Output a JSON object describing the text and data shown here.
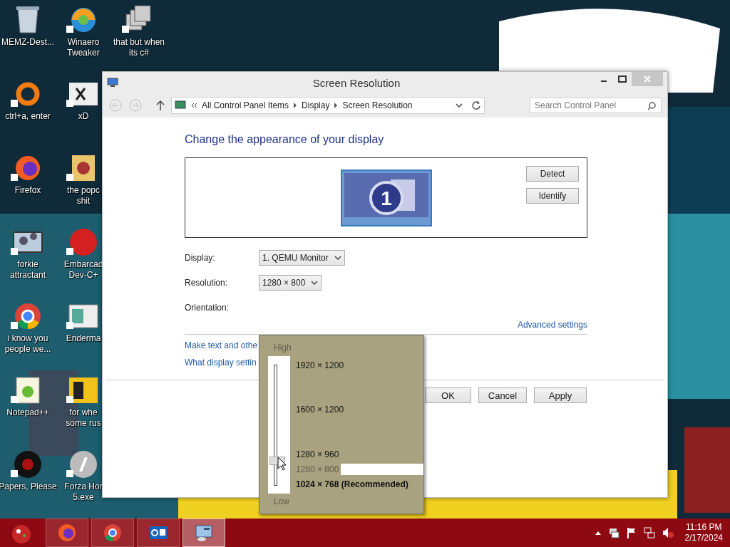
{
  "desktop": {
    "wallpaper": {
      "kind": "picture"
    },
    "icon_columns": [
      [
        {
          "label": "MEMZ-Dest..."
        },
        {
          "label": "ctrl+a, enter"
        },
        {
          "label": "Firefox"
        },
        {
          "label": "forkie\nattractant"
        },
        {
          "label": "i know you\npeople we..."
        },
        {
          "label": "Notepad++"
        },
        {
          "label": "Papers, Please"
        }
      ],
      [
        {
          "label": "Winaero\nTweaker"
        },
        {
          "label": "xD"
        },
        {
          "label": "the popc\nshit"
        },
        {
          "label": "Embarcad\nDev-C+"
        },
        {
          "label": "Enderma"
        },
        {
          "label": "for whe\nsome rus"
        },
        {
          "label": "Forza Hor\n5.exe"
        }
      ],
      [
        {
          "label": "that but when\nits c#"
        }
      ]
    ]
  },
  "window": {
    "title": "Screen Resolution",
    "address": {
      "crumbs": [
        "All Control Panel Items",
        "Display",
        "Screen Resolution"
      ]
    },
    "search": {
      "placeholder": "Search Control Panel"
    },
    "heading": "Change the appearance of your display",
    "monitor_number": "1",
    "side_buttons": [
      "Detect",
      "Identify"
    ],
    "fields": [
      {
        "label": "Display:",
        "value": "1. QEMU Monitor"
      },
      {
        "label": "Resolution:",
        "value": "1280 × 800"
      },
      {
        "label": "Orientation:"
      }
    ],
    "advanced_link": "Advanced settings",
    "links": [
      "Make text and othe",
      "What display settin"
    ],
    "buttons": [
      "OK",
      "Cancel",
      "Apply"
    ],
    "resolution_popup": {
      "high_label": "High",
      "low_label": "Low",
      "level": 0.2,
      "options": [
        {
          "label": "1920 × 1200",
          "selected": false,
          "kind": "normal"
        },
        {
          "label": "1600 × 1200",
          "selected": false,
          "kind": "normal"
        },
        {
          "label": "1280 × 960",
          "selected": false,
          "kind": "normal"
        },
        {
          "label": "1280 × 800",
          "selected": true,
          "kind": "normal"
        },
        {
          "label": "1024 × 768 (Recommended)",
          "selected": false,
          "kind": "recommended"
        }
      ]
    }
  },
  "taskbar": {
    "apps": [
      {
        "selected": false
      },
      {
        "selected": false
      },
      {
        "selected": false
      },
      {
        "selected": true
      }
    ],
    "time": "11:16 PM",
    "date": "2/17/2024"
  }
}
